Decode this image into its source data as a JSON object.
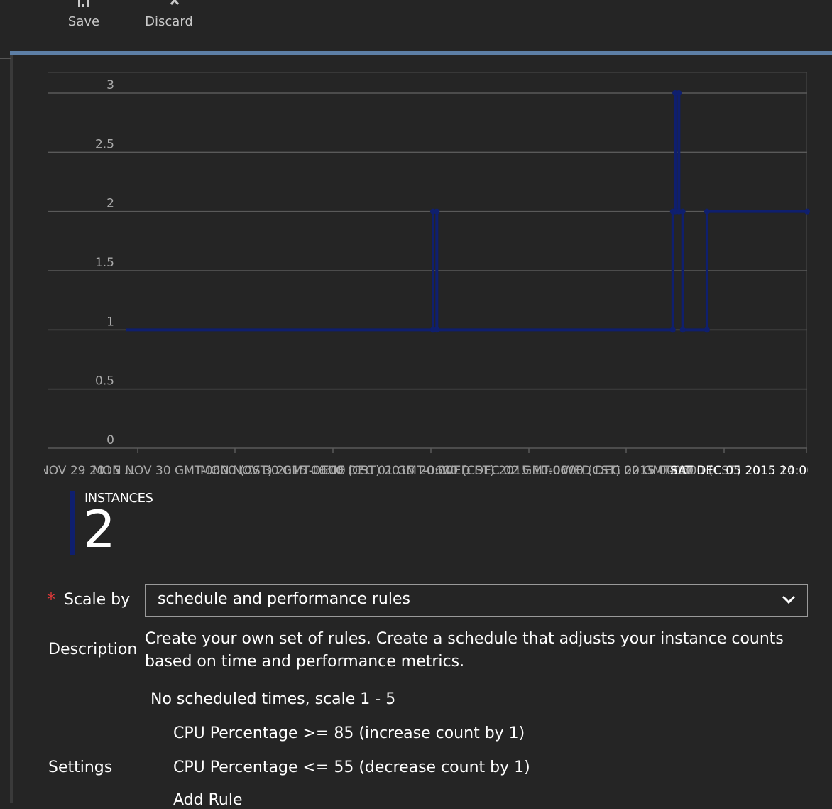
{
  "toolbar": {
    "save_label": "Save",
    "discard_label": "Discard",
    "save_icon": "save-icon",
    "discard_icon": "close-icon"
  },
  "colors": {
    "background": "#252525",
    "accent_line": "#5d7fa6",
    "series": "#0f1f6e",
    "gridline": "#5a5a5a",
    "required": "#e03a3a"
  },
  "chart_data": {
    "type": "line",
    "title": "",
    "xlabel": "",
    "ylabel": "",
    "ylim": [
      0,
      3
    ],
    "yticks": [
      "0",
      "0.5",
      "1",
      "1.5",
      "2",
      "2.5",
      "3"
    ],
    "grid": true,
    "xtick_labels": [
      "NOV 29 2015 ...",
      "MON NOV 30 GMT-0600 (CST) 2015 06:00",
      "MON NOV 30 GMT-0600 (CST) 2015 20:00",
      "TUE DEC 01 GMT-0600 (CST) 2015 10:00",
      "WED DEC 02 GMT-0600 (CST) 2015 00:00",
      "WED DEC 02 GMT-0600 (CST) 2015 14:00",
      "SAT DEC 05 2015 20:0"
    ],
    "series": [
      {
        "points": [
          [
            0.102,
            1
          ],
          [
            0.507,
            1
          ],
          [
            0.507,
            2
          ],
          [
            0.512,
            2
          ],
          [
            0.512,
            1
          ],
          [
            0.823,
            1
          ],
          [
            0.823,
            2
          ],
          [
            0.826,
            2
          ],
          [
            0.826,
            3
          ],
          [
            0.831,
            3
          ],
          [
            0.831,
            2
          ],
          [
            0.836,
            2
          ],
          [
            0.836,
            1
          ],
          [
            0.868,
            1
          ],
          [
            0.868,
            2
          ],
          [
            1.0,
            2
          ]
        ]
      }
    ]
  },
  "instances": {
    "title": "INSTANCES",
    "value": "2"
  },
  "scale_by": {
    "label": "Scale by",
    "required_mark": "*",
    "selected": "schedule and performance rules",
    "icon": "chevron-down-icon"
  },
  "description": {
    "label": "Description",
    "text": "Create your own set of rules. Create a schedule that adjusts your instance counts based on time and performance metrics."
  },
  "settings": {
    "label": "Settings",
    "schedule": "No scheduled times, scale 1 - 5",
    "rules": [
      "CPU Percentage >= 85 (increase count by 1)",
      "CPU Percentage <= 55 (decrease count by 1)"
    ],
    "add_rule": "Add Rule"
  }
}
